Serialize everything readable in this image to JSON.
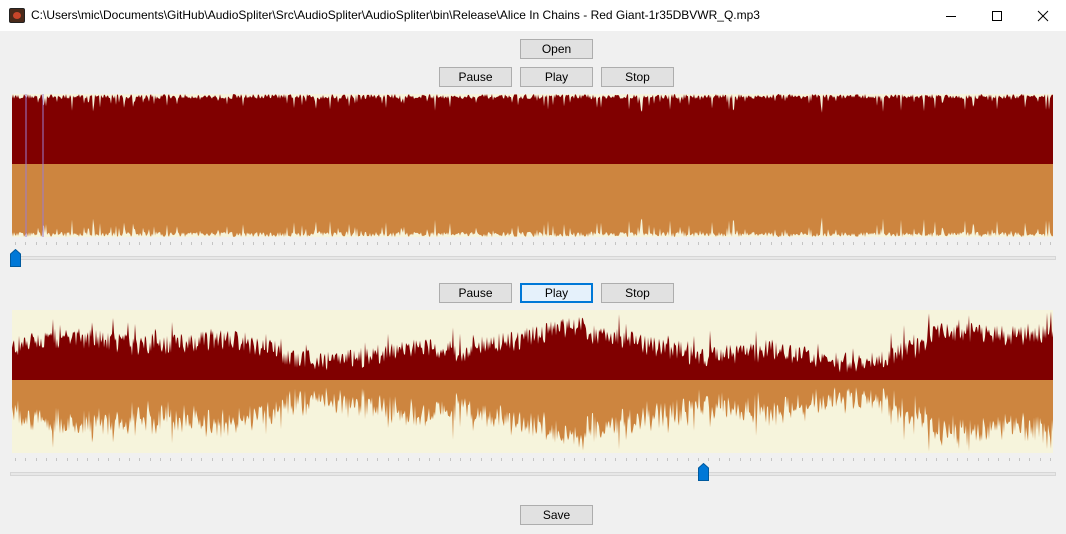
{
  "window": {
    "title": "C:\\Users\\mic\\Documents\\GitHub\\AudioSpliter\\Src\\AudioSpliter\\AudioSpliter\\bin\\Release\\Alice In Chains - Red Giant-1r35DBVWR_Q.mp3",
    "controls": [
      "minimize-icon",
      "maximize-icon",
      "close-icon"
    ]
  },
  "toolbar": {
    "open_label": "Open"
  },
  "player1": {
    "pause_label": "Pause",
    "play_label": "Play",
    "stop_label": "Stop",
    "position_fraction": 0.0,
    "waveform_colors": {
      "top": "#800000",
      "bottom": "#cd853f",
      "background": "#f6f4dc"
    }
  },
  "player2": {
    "pause_label": "Pause",
    "play_label": "Play",
    "stop_label": "Stop",
    "position_fraction": 0.665,
    "waveform_colors": {
      "top": "#800000",
      "bottom": "#cd853f",
      "background": "#f6f4dc"
    }
  },
  "footer": {
    "save_label": "Save"
  },
  "colors": {
    "accent": "#0078d7",
    "button_face": "#e1e1e1",
    "window_bg": "#f0f0f0"
  }
}
